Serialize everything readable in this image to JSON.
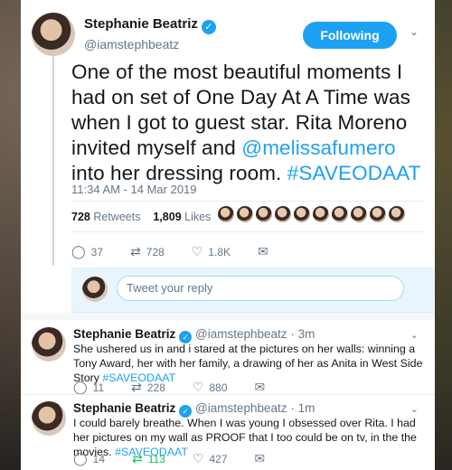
{
  "author": {
    "display_name": "Stephanie Beatriz",
    "handle": "@iamstephbeatz",
    "verified_mark": "✓"
  },
  "follow_button": "Following",
  "caret": "⌄",
  "main_tweet": {
    "text_before": "One of the most beautiful moments I had on set of One Day At A Time was when I got to guest star. Rita Moreno invited myself and ",
    "mention": "@melissafumero",
    "text_middle": " into her dressing room. ",
    "hashtag": "#SAVEODAAT",
    "timestamp": "11:34 AM - 14 Mar 2019",
    "retweets_count": "728",
    "retweets_label": "Retweets",
    "likes_count": "1,809",
    "likes_label": "Likes",
    "likers_count": 10,
    "actions": {
      "replies": "37",
      "retweets": "728",
      "likes": "1.8K"
    }
  },
  "reply_composer": {
    "placeholder": "Tweet your reply"
  },
  "thread": [
    {
      "display_name": "Stephanie Beatriz",
      "handle": "@iamstephbeatz",
      "time": "· 3m",
      "text_before": "She ushered us in and i stared at the pictures on her walls: winning a Tony Award, her with her family, a drawing of her as Anita in West Side Story ",
      "hashtag": "#SAVEODAAT",
      "actions": {
        "replies": "11",
        "retweets": "228",
        "likes": "880"
      }
    },
    {
      "display_name": "Stephanie Beatriz",
      "handle": "@iamstephbeatz",
      "time": "· 1m",
      "text_before": "I could barely breathe. When I was young I obsessed over Rita. I had her pictures on my wall as PROOF that I too could be on tv, in the the movies. ",
      "hashtag": "#SAVEODAAT",
      "actions": {
        "replies": "14",
        "retweets": "113",
        "likes": "427"
      }
    }
  ],
  "icons": {
    "reply": "◯",
    "retweet": "⇄",
    "like": "♡",
    "message": "✉"
  },
  "colors": {
    "accent": "#1da1f2",
    "retweet_active": "#17bf63",
    "muted": "#657786"
  }
}
